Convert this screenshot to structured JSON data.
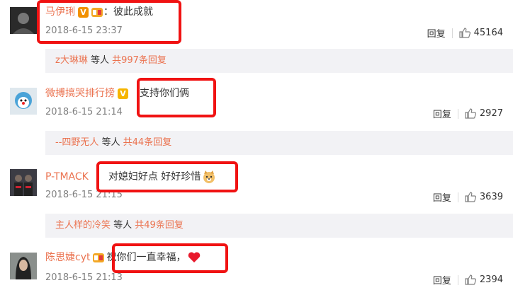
{
  "comments": [
    {
      "username": "马伊琍",
      "text": "：彼此成就",
      "time": "2018-6-15 23:37",
      "reply_label": "回复",
      "likes": "45164",
      "badge": "V",
      "avatar_icon": "user-avatar"
    },
    {
      "username": "微搏搞哭排行搒",
      "text": "支持你们俩",
      "time": "2018-6-15 21:14",
      "reply_label": "回复",
      "likes": "2927",
      "badge": "V",
      "avatar_icon": "user-avatar"
    },
    {
      "username": "P-TMACK",
      "text": "对媳妇好点  好好珍惜",
      "time": "2018-6-15 21:15",
      "reply_label": "回复",
      "likes": "3639",
      "emoji": "doge-emoji",
      "avatar_icon": "user-avatar"
    },
    {
      "username": "陈思婕cyt",
      "text": "祝你们一直幸福，",
      "time": "2018-6-15 21:13",
      "reply_label": "回复",
      "likes": "2394",
      "emoji": "heart-emoji",
      "avatar_icon": "user-avatar"
    }
  ],
  "replies": [
    {
      "user": "z大琳琳",
      "middle": " 等人 ",
      "count": "共997条回复"
    },
    {
      "user": "--四野无人",
      "middle": " 等人 ",
      "count": "共44条回复"
    },
    {
      "user": "主人样的冷笑",
      "middle": " 等人 ",
      "count": "共49条回复"
    }
  ],
  "colors": {
    "username": "#eb7350",
    "highlight_box": "#f01212",
    "reply_bg": "#f2f2f5",
    "time": "#808080"
  }
}
